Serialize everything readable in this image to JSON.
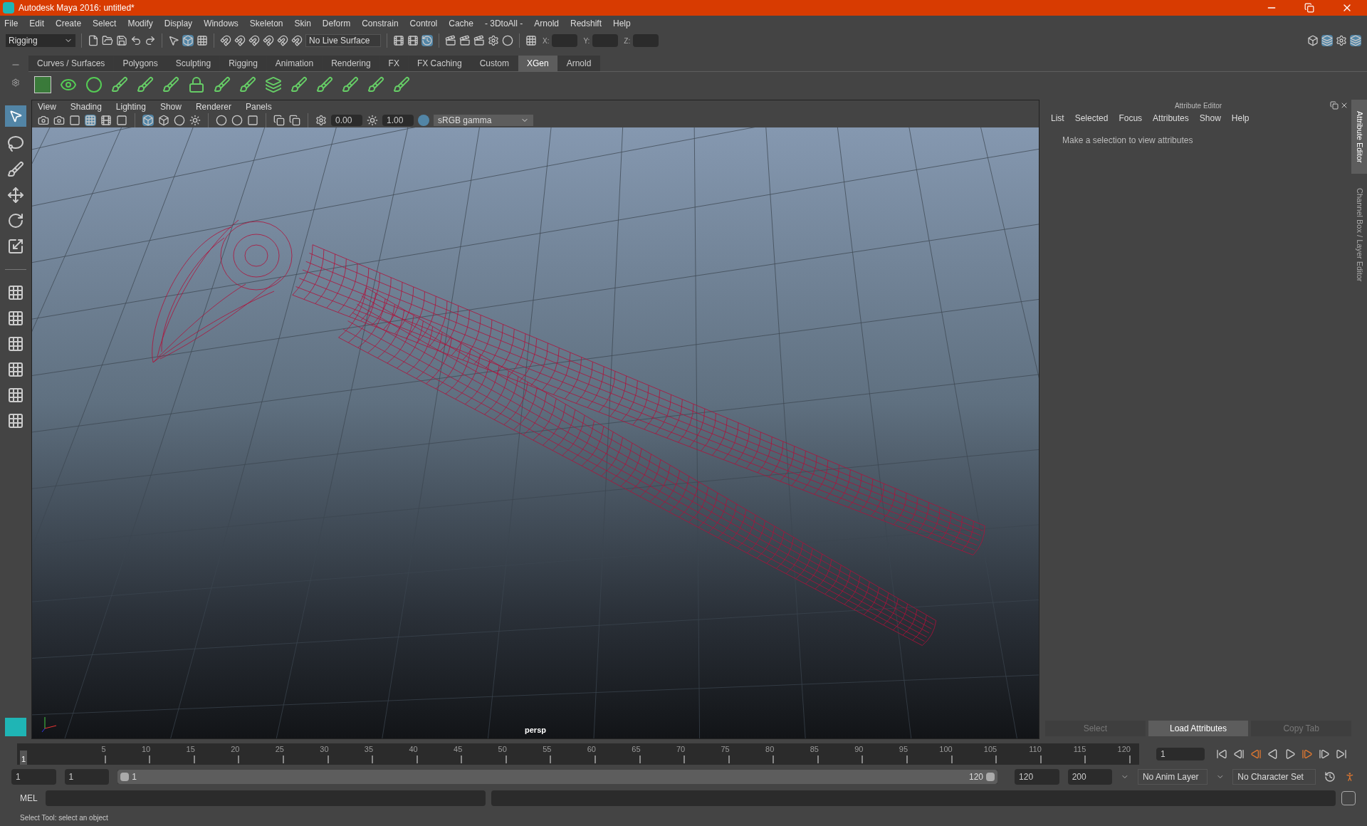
{
  "window": {
    "title": "Autodesk Maya 2016: untitled*"
  },
  "menu_bar": [
    "File",
    "Edit",
    "Create",
    "Select",
    "Modify",
    "Display",
    "Windows",
    "Skeleton",
    "Skin",
    "Deform",
    "Constrain",
    "Control",
    "Cache",
    "- 3DtoAll -",
    "Arnold",
    "Redshift",
    "Help"
  ],
  "status_line": {
    "menu_set": "Rigging",
    "live_surface": "No Live Surface",
    "coordinates": [
      {
        "label": "X:"
      },
      {
        "label": "Y:"
      },
      {
        "label": "Z:"
      }
    ]
  },
  "shelf_tabs": [
    {
      "label": "Curves / Surfaces",
      "selected": false
    },
    {
      "label": "Polygons",
      "selected": false
    },
    {
      "label": "Sculpting",
      "selected": false
    },
    {
      "label": "Rigging",
      "selected": false
    },
    {
      "label": "Animation",
      "selected": false
    },
    {
      "label": "Rendering",
      "selected": false
    },
    {
      "label": "FX",
      "selected": false
    },
    {
      "label": "FX Caching",
      "selected": false
    },
    {
      "label": "Custom",
      "selected": false
    },
    {
      "label": "XGen",
      "selected": true
    },
    {
      "label": "Arnold",
      "selected": false
    }
  ],
  "viewport": {
    "menus": [
      "View",
      "Shading",
      "Lighting",
      "Show",
      "Renderer",
      "Panels"
    ],
    "exposure": "0.00",
    "gamma": "1.00",
    "color_space": "sRGB gamma",
    "camera_label": "persp"
  },
  "attribute_editor": {
    "title": "Attribute Editor",
    "menus": [
      "List",
      "Selected",
      "Focus",
      "Attributes",
      "Show",
      "Help"
    ],
    "message": "Make a selection to view attributes",
    "buttons": [
      {
        "label": "Select",
        "disabled": true
      },
      {
        "label": "Load Attributes",
        "disabled": false
      },
      {
        "label": "Copy Tab",
        "disabled": true
      }
    ]
  },
  "side_tabs": [
    {
      "label": "Attribute Editor",
      "selected": true
    },
    {
      "label": "Channel Box / Layer Editor",
      "selected": false
    }
  ],
  "time_slider": {
    "current_marker": "1",
    "ticks": [
      "5",
      "10",
      "15",
      "20",
      "25",
      "30",
      "35",
      "40",
      "45",
      "50",
      "55",
      "60",
      "65",
      "70",
      "75",
      "80",
      "85",
      "90",
      "95",
      "100",
      "105",
      "110",
      "115",
      "120"
    ],
    "current_frame": "1",
    "level": 0
  },
  "range_slider": {
    "start_time": "1",
    "playback_start": "1",
    "range_start": "1",
    "range_end": "120",
    "playback_end": "120",
    "end_time": "200",
    "anim_layer": "No Anim Layer",
    "character_set": "No Character Set",
    "level": 1
  },
  "command_line": {
    "label": "MEL"
  },
  "help_line": "Select Tool: select an object"
}
